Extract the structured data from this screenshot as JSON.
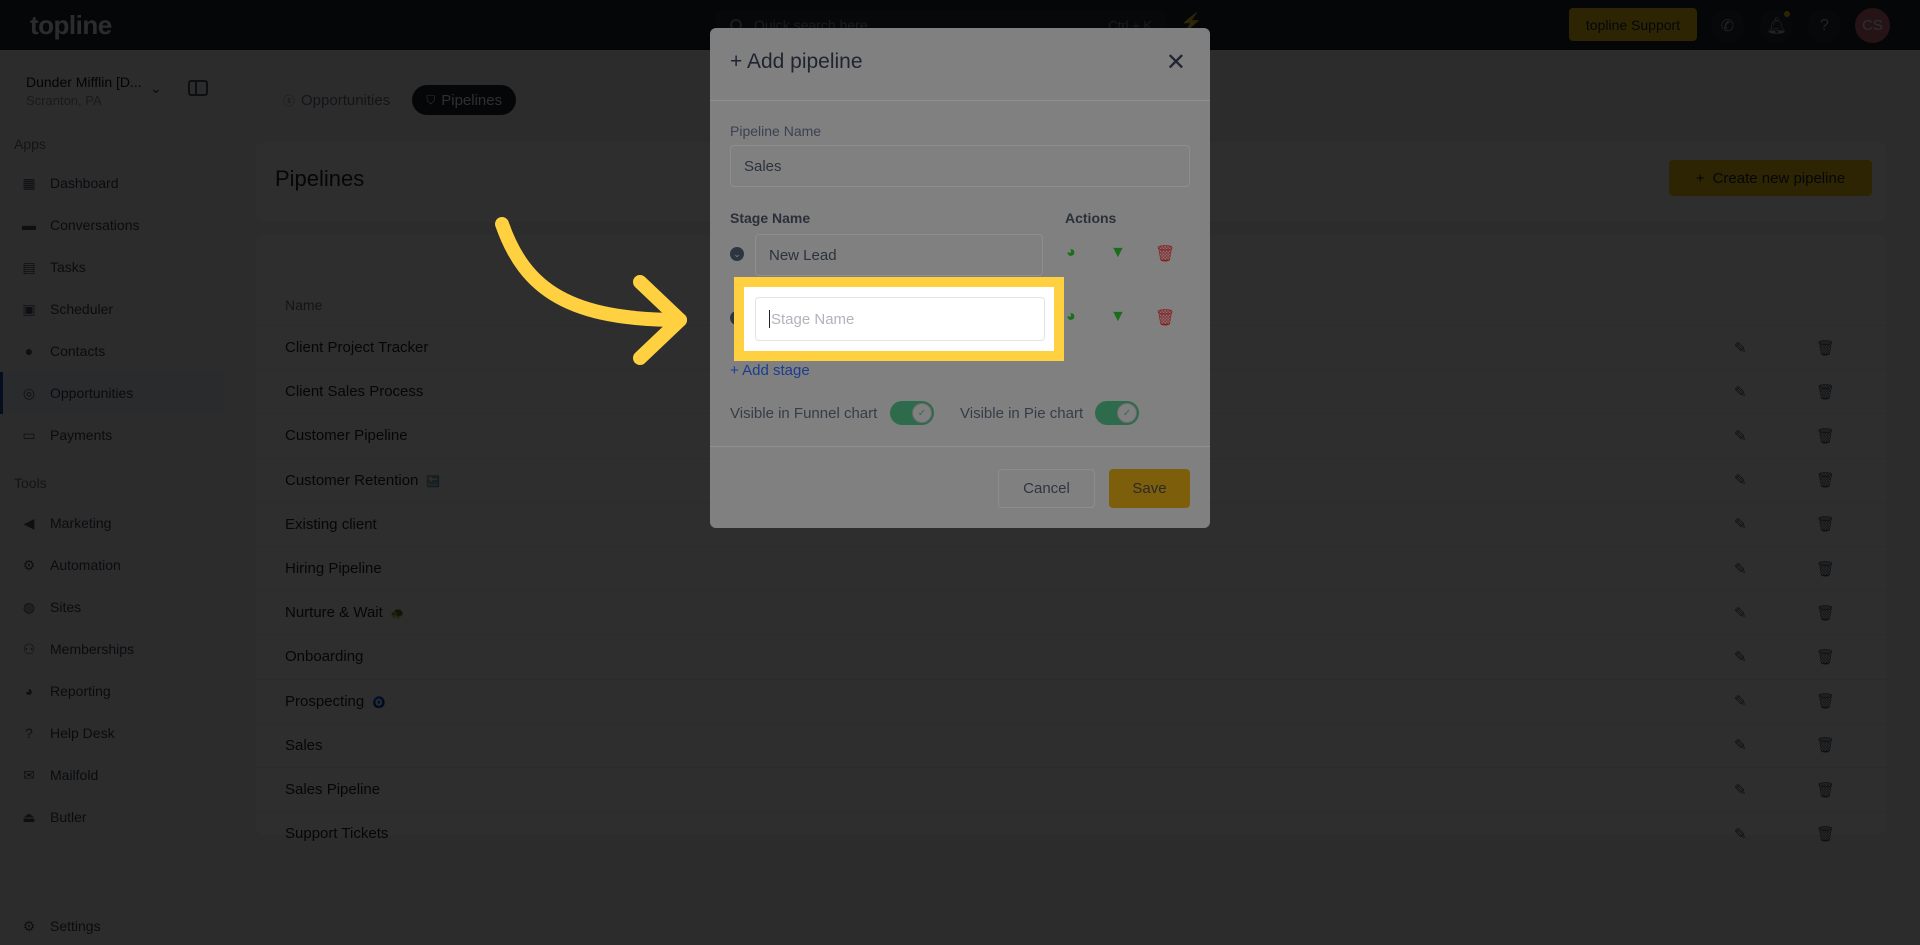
{
  "topbar": {
    "logo": "topline",
    "search_placeholder": "Quick search here",
    "search_shortcut": "Ctrl + K",
    "support_label": "topline Support",
    "avatar_initials": "CS"
  },
  "sidebar": {
    "account_name": "Dunder Mifflin [D...",
    "account_location": "Scranton, PA",
    "apps_label": "Apps",
    "apps": [
      {
        "label": "Dashboard",
        "icon": "dashboard-icon"
      },
      {
        "label": "Conversations",
        "icon": "chat-icon"
      },
      {
        "label": "Tasks",
        "icon": "task-icon"
      },
      {
        "label": "Scheduler",
        "icon": "calendar-icon"
      },
      {
        "label": "Contacts",
        "icon": "person-icon"
      },
      {
        "label": "Opportunities",
        "icon": "target-icon",
        "active": true
      },
      {
        "label": "Payments",
        "icon": "card-icon"
      }
    ],
    "tools_label": "Tools",
    "tools": [
      {
        "label": "Marketing",
        "icon": "megaphone-icon"
      },
      {
        "label": "Automation",
        "icon": "gears-icon"
      },
      {
        "label": "Sites",
        "icon": "globe-icon"
      },
      {
        "label": "Memberships",
        "icon": "users-icon"
      },
      {
        "label": "Reporting",
        "icon": "pie-icon"
      },
      {
        "label": "Help Desk",
        "icon": "help-icon"
      },
      {
        "label": "Mailfold",
        "icon": "mail-icon"
      },
      {
        "label": "Butler",
        "icon": "bell-icon"
      }
    ],
    "settings_label": "Settings"
  },
  "main": {
    "tabs": [
      {
        "label": "Opportunities",
        "active": false
      },
      {
        "label": "Pipelines",
        "active": true
      }
    ],
    "page_title": "Pipelines",
    "create_button": "Create new pipeline",
    "table": {
      "column_name": "Name",
      "rows": [
        {
          "name": "Client Project Tracker",
          "emoji": ""
        },
        {
          "name": "Client Sales Process",
          "emoji": ""
        },
        {
          "name": "Customer Pipeline",
          "emoji": ""
        },
        {
          "name": "Customer Retention",
          "emoji": "🔙"
        },
        {
          "name": "Existing client",
          "emoji": ""
        },
        {
          "name": "Hiring Pipeline",
          "emoji": ""
        },
        {
          "name": "Nurture & Wait",
          "emoji": "🐢"
        },
        {
          "name": "Onboarding",
          "emoji": ""
        },
        {
          "name": "Prospecting",
          "emoji": "🧿"
        },
        {
          "name": "Sales",
          "emoji": ""
        },
        {
          "name": "Sales Pipeline",
          "emoji": ""
        },
        {
          "name": "Support Tickets",
          "emoji": ""
        }
      ]
    }
  },
  "modal": {
    "title": "+ Add pipeline",
    "pipeline_name_label": "Pipeline Name",
    "pipeline_name_value": "Sales",
    "stage_name_header": "Stage Name",
    "actions_header": "Actions",
    "stages": [
      {
        "value": "New Lead",
        "placeholder": "Stage Name"
      },
      {
        "value": "",
        "placeholder": "Stage Name"
      }
    ],
    "add_stage_label": "Add stage",
    "funnel_toggle_label": "Visible in Funnel chart",
    "funnel_toggle_on": true,
    "pie_toggle_label": "Visible in Pie chart",
    "pie_toggle_on": true,
    "cancel_label": "Cancel",
    "save_label": "Save"
  },
  "colors": {
    "accent_yellow": "#f2c80f",
    "highlight_yellow": "#ffd140",
    "action_green": "#1a6e1a",
    "action_red": "#8b1a1a",
    "toggle_green": "#2e6b4c"
  }
}
